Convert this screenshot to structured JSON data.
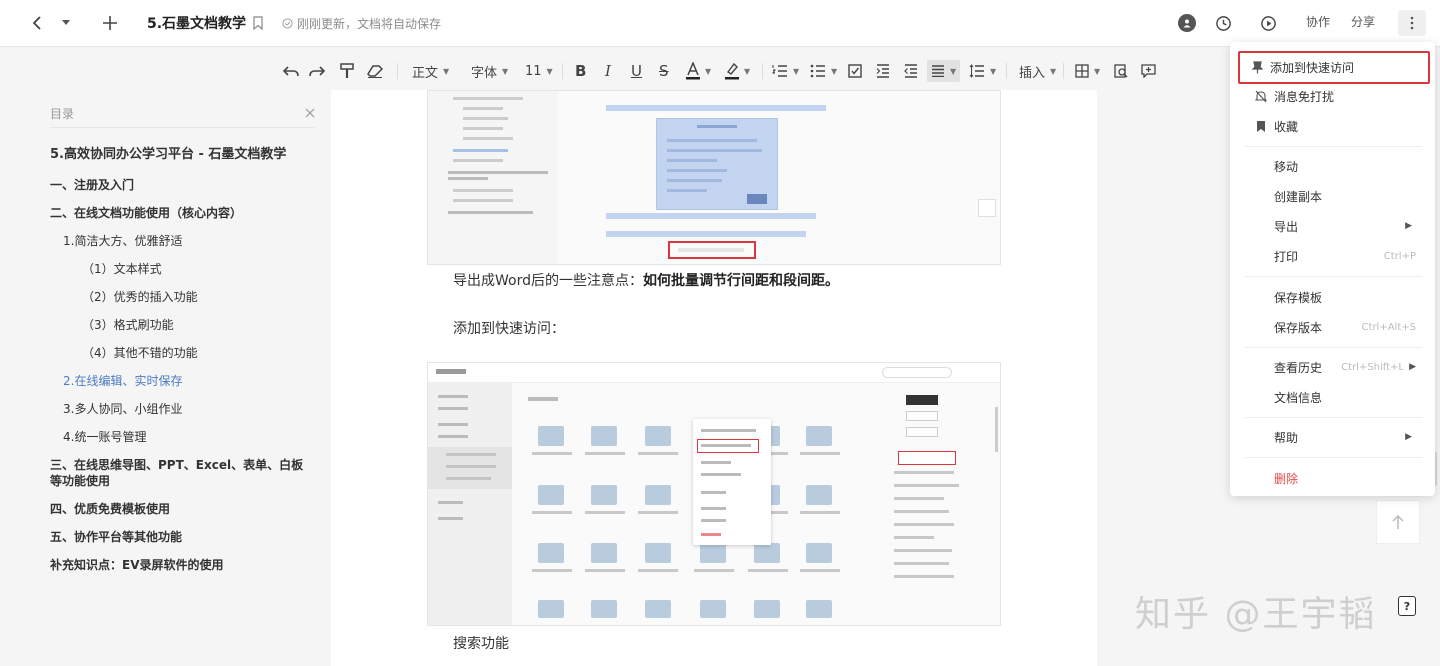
{
  "topbar": {
    "title": "5.石墨文档教学",
    "save_status": "刚刚更新，文档将自动保存",
    "avatar_text": "●",
    "collab_label": "协作",
    "share_label": "分享"
  },
  "toolbar": {
    "style_label": "正文",
    "font_label": "字体",
    "size_label": "11",
    "insert_label": "插入"
  },
  "toc": {
    "header": "目录",
    "items": [
      "5.高效协同办公学习平台 - 石墨文档教学",
      "一、注册及入门",
      "二、在线文档功能使用（核心内容）",
      "1.简洁大方、优雅舒适",
      "（1）文本样式",
      "（2）优秀的插入功能",
      "（3）格式刷功能",
      "（4）其他不错的功能",
      "2.在线编辑、实时保存",
      "3.多人协同、小组作业",
      "4.统一账号管理",
      "三、在线思维导图、PPT、Excel、表单、白板等功能使用",
      "四、优质免费模板使用",
      "五、协作平台等其他功能",
      "补充知识点：EV录屏软件的使用"
    ]
  },
  "content": {
    "para1_prefix": "导出成Word后的一些注意点：",
    "para1_bold": "如何批量调节行间距和段间距。",
    "para2": "添加到快速访问：",
    "para3": "搜索功能"
  },
  "menu": {
    "items": [
      "添加到快速访问",
      "消息免打扰",
      "收藏",
      "移动",
      "创建副本",
      "导出",
      "打印",
      "保存模板",
      "保存版本",
      "查看历史",
      "文档信息",
      "帮助",
      "删除"
    ],
    "shortcuts": {
      "print": "Ctrl+P",
      "save_version": "Ctrl+Alt+S",
      "history": "Ctrl+Shift+L"
    }
  },
  "watermark": "知乎 @王宇韬",
  "colors": {
    "highlight_border": "#d9363e",
    "toc_active": "#4a7bc5",
    "danger": "#e34b4b"
  }
}
